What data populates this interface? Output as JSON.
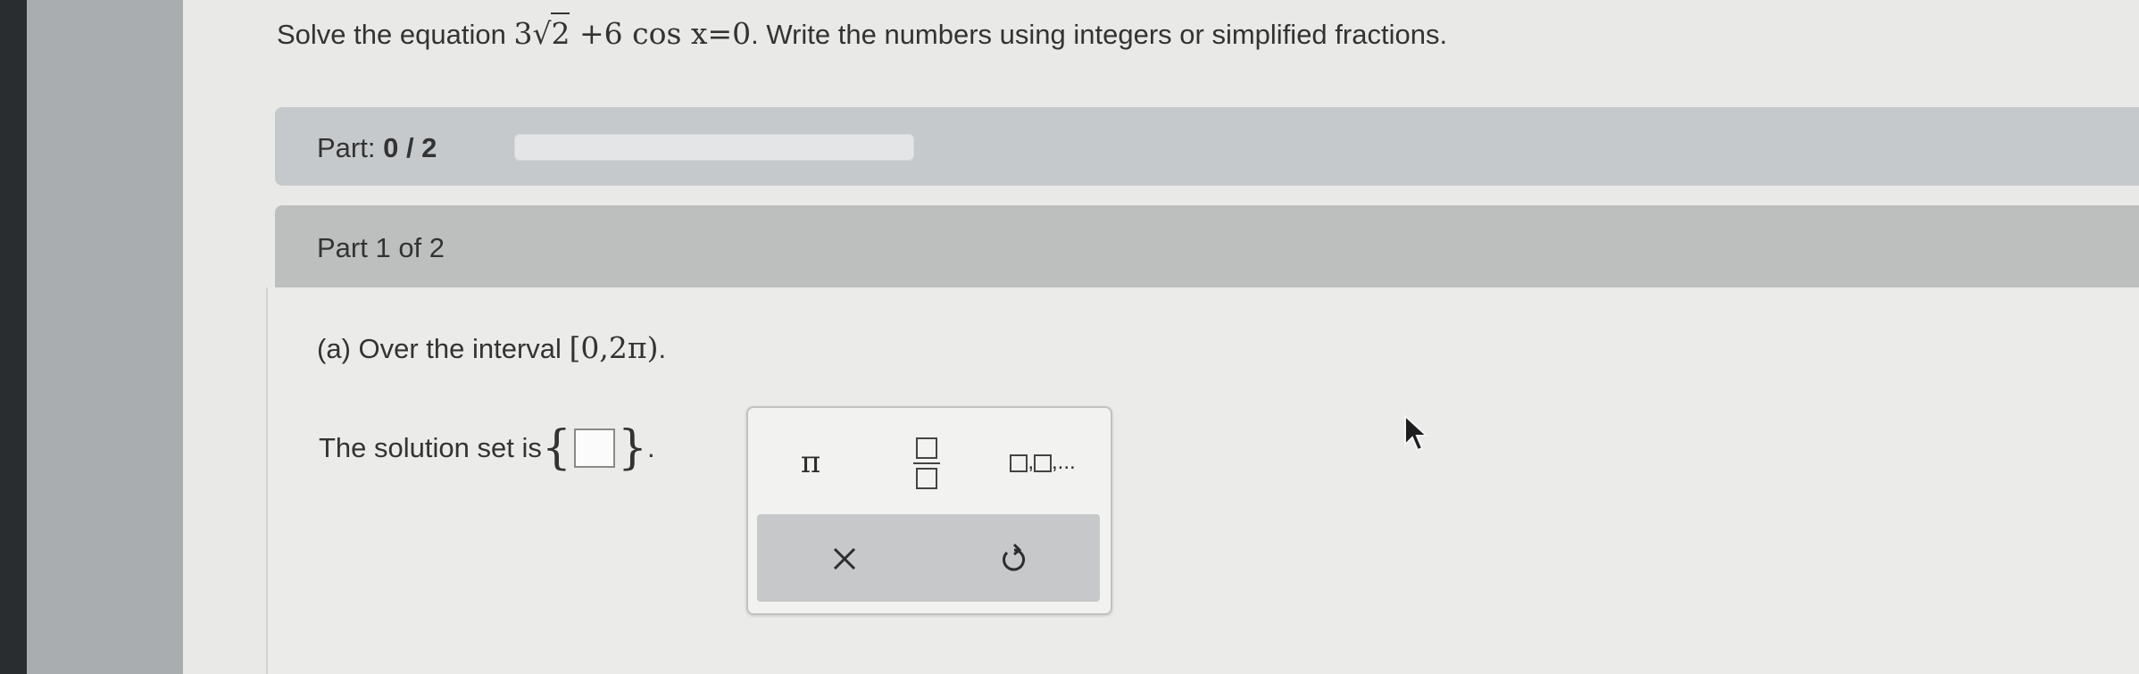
{
  "question": {
    "prefix": "Solve the equation ",
    "coef1": "3",
    "radicand": "2",
    "tail": "+6 cos x=0",
    "suffix": ". Write the numbers using integers or simplified fractions."
  },
  "progress": {
    "label": "Part:",
    "value": "0 / 2",
    "fraction": 0
  },
  "part_title": "Part 1 of 2",
  "sub_question": {
    "text": "(a) Over the interval ",
    "interval": "[0,2π)",
    "end": "."
  },
  "solution": {
    "label": "The solution set is ",
    "open_brace": "{",
    "close_brace": "}",
    "period": "."
  },
  "keypad": {
    "pi": "π",
    "fraction_icon": "fraction-icon",
    "list_icon": "list-icon",
    "list_ellipsis": ",...",
    "clear_icon": "close-icon",
    "undo_icon": "undo-icon"
  },
  "colors": {
    "accent": "#2f80c6",
    "panel_bg": "#ebebea",
    "header_bg": "#bdbfbf"
  }
}
